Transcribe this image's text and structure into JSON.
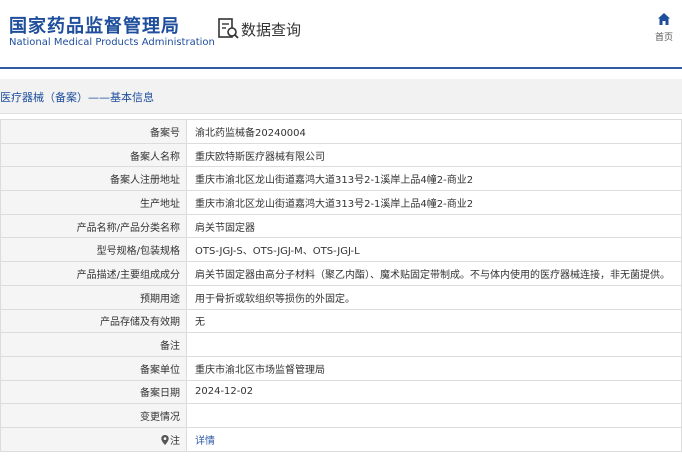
{
  "header": {
    "brand_cn": "国家药品监督管理局",
    "brand_en": "National Medical Products Administration",
    "db_title": "数据查询",
    "home_label": "首页"
  },
  "section": {
    "title": "医疗器械（备案）——基本信息"
  },
  "colors": {
    "brand": "#1e4e9c",
    "accent_line": "#2e5aa8",
    "label_bg": "#f5f5f5",
    "border": "#dcdcdc"
  },
  "rows": [
    {
      "label": "备案号",
      "value": "渝北药监械备20240004"
    },
    {
      "label": "备案人名称",
      "value": "重庆欧特斯医疗器械有限公司"
    },
    {
      "label": "备案人注册地址",
      "value": "重庆市渝北区龙山街道嘉鸿大道313号2-1溪岸上品4幢2-商业2"
    },
    {
      "label": "生产地址",
      "value": "重庆市渝北区龙山街道嘉鸿大道313号2-1溪岸上品4幢2-商业2"
    },
    {
      "label": "产品名称/产品分类名称",
      "value": "肩关节固定器"
    },
    {
      "label": "型号规格/包装规格",
      "value": "OTS-JGJ-S、OTS-JGJ-M、OTS-JGJ-L"
    },
    {
      "label": "产品描述/主要组成成分",
      "value": "肩关节固定器由高分子材料（聚乙内酯）、魔术贴固定带制成。不与体内使用的医疗器械连接，非无菌提供。"
    },
    {
      "label": "预期用途",
      "value": "用于骨折或软组织等损伤的外固定。"
    },
    {
      "label": "产品存储及有效期",
      "value": "无"
    },
    {
      "label": "备注",
      "value": ""
    },
    {
      "label": "备案单位",
      "value": "重庆市渝北区市场监督管理局"
    },
    {
      "label": "备案日期",
      "value": "2024-12-02"
    },
    {
      "label": "变更情况",
      "value": ""
    }
  ],
  "note_row": {
    "label": "注",
    "link_text": "详情",
    "icon": "location-pin-icon"
  },
  "icons": {
    "db": "database-search-icon",
    "home": "home-icon"
  }
}
